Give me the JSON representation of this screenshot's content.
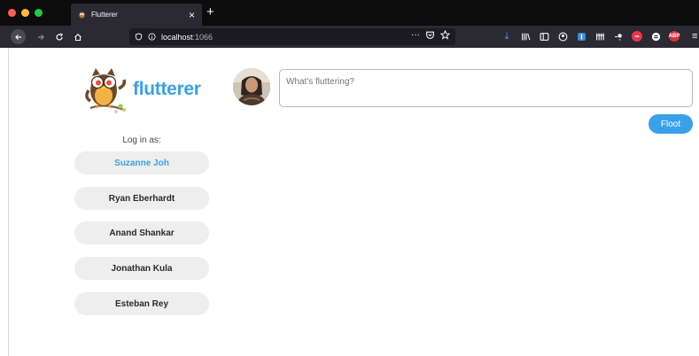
{
  "browser": {
    "tab_title": "Flutterer",
    "tab_close": "×",
    "new_tab": "+",
    "url_host": "localhost",
    "url_port": ":1066",
    "url_more": "···",
    "menu": "≡"
  },
  "app": {
    "brand_name": "flutterer",
    "login_label": "Log in as:",
    "users": [
      {
        "name": "Suzanne Joh",
        "active": true
      },
      {
        "name": "Ryan Eberhardt",
        "active": false
      },
      {
        "name": "Anand Shankar",
        "active": false
      },
      {
        "name": "Jonathan Kula",
        "active": false
      },
      {
        "name": "Esteban Rey",
        "active": false
      }
    ],
    "compose_placeholder": "What's fluttering?",
    "post_button": "Floot"
  },
  "colors": {
    "accent": "#3aa0ea",
    "button_bg": "#eeeeee",
    "chrome_dark": "#2b2a33"
  },
  "icons": {
    "tab_favicon": "owl-icon",
    "back": "back-arrow-icon",
    "forward": "forward-arrow-icon",
    "reload": "reload-icon",
    "home": "home-icon",
    "tracking": "shield-icon",
    "info": "info-icon",
    "pocket": "pocket-icon",
    "bookmark": "star-icon"
  }
}
